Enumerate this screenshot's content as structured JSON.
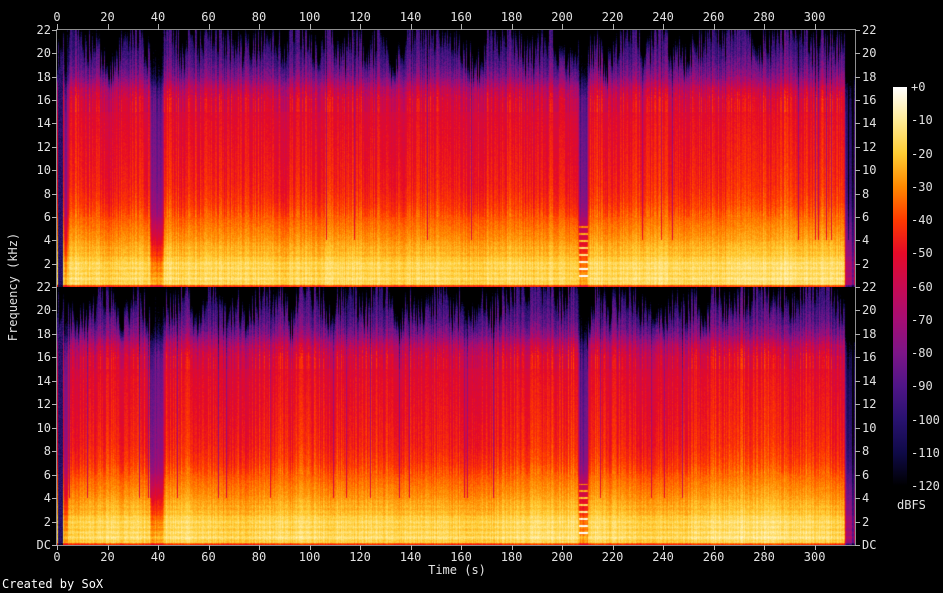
{
  "footer": {
    "credit": "Created by SoX"
  },
  "axes": {
    "x_title": "Time (s)",
    "y_title": "Frequency (kHz)",
    "x_tick_labels": [
      "0",
      "20",
      "40",
      "60",
      "80",
      "100",
      "120",
      "140",
      "160",
      "180",
      "200",
      "220",
      "240",
      "260",
      "280",
      "300"
    ],
    "freq_tick_labels_channel1": [
      "22",
      "20",
      "18",
      "16",
      "14",
      "12",
      "10",
      "8",
      "6",
      "4",
      "2"
    ],
    "freq_tick_labels_channel2": [
      "22",
      "20",
      "18",
      "16",
      "14",
      "12",
      "10",
      "8",
      "6",
      "4",
      "2",
      "DC"
    ]
  },
  "colorbar": {
    "unit_label": "dBFS",
    "tick_labels": [
      "+0",
      "-10",
      "-20",
      "-30",
      "-40",
      "-50",
      "-60",
      "-70",
      "-80",
      "-90",
      "-100",
      "-110",
      "-120"
    ],
    "gradient_hex": [
      "#ffffff",
      "#ffeb96",
      "#ffcc33",
      "#ff8800",
      "#ff3a00",
      "#e50a28",
      "#c70a52",
      "#a50d74",
      "#7d1587",
      "#4f1587",
      "#291270",
      "#0f0a48",
      "#000000"
    ]
  },
  "chart_data": {
    "type": "heatmap",
    "subtype": "stereo_spectrogram",
    "channels": 2,
    "x_axis": {
      "label": "Time (s)",
      "range_s": [
        0,
        316
      ],
      "tick_step_s": 20
    },
    "y_axis": {
      "label": "Frequency (kHz)",
      "range_khz": [
        0,
        22
      ],
      "tick_step_khz": 2,
      "dc_label": "DC"
    },
    "z_axis": {
      "label": "dBFS",
      "range_db": [
        0,
        -120
      ],
      "tick_step_db": 10
    },
    "palette_db_hex": [
      [
        0,
        "#ffffff"
      ],
      [
        -10,
        "#ffeb96"
      ],
      [
        -20,
        "#ffcc33"
      ],
      [
        -30,
        "#ff8800"
      ],
      [
        -40,
        "#ff3a00"
      ],
      [
        -50,
        "#e50a28"
      ],
      [
        -60,
        "#c70a52"
      ],
      [
        -70,
        "#a50d74"
      ],
      [
        -80,
        "#7d1587"
      ],
      [
        -90,
        "#4f1587"
      ],
      [
        -100,
        "#291270"
      ],
      [
        -110,
        "#0f0a48"
      ],
      [
        -120,
        "#000000"
      ]
    ],
    "spectral_profile_khz_db": [
      [
        0,
        -30
      ],
      [
        0.15,
        -22
      ],
      [
        0.4,
        -16
      ],
      [
        1,
        -14
      ],
      [
        2,
        -17
      ],
      [
        3,
        -22
      ],
      [
        4,
        -27
      ],
      [
        5.5,
        -33
      ],
      [
        7,
        -40
      ],
      [
        8.5,
        -44
      ],
      [
        11,
        -47
      ],
      [
        14,
        -50
      ],
      [
        16,
        -54
      ],
      [
        17,
        -62
      ],
      [
        18,
        -78
      ],
      [
        19,
        -88
      ],
      [
        20.5,
        -97
      ],
      [
        22,
        -101
      ]
    ],
    "quiet_regions_s": [
      {
        "start": 0,
        "end": 2.2,
        "attenuation_db": 85,
        "mode": "blackout"
      },
      {
        "start": 2.2,
        "end": 4.6,
        "attenuation_db": 30,
        "mode": "lowpass"
      },
      {
        "start": 36.5,
        "end": 42.5,
        "attenuation_db": 35,
        "mode": "lowpass"
      },
      {
        "start": 206,
        "end": 210.5,
        "attenuation_db": 38,
        "mode": "lowpass"
      },
      {
        "start": 311.5,
        "end": 316,
        "attenuation_db": 52,
        "mode": "uniform"
      }
    ],
    "dotted_tones": {
      "start_s": 206.4,
      "end_s": 210.2,
      "freq_khz_min": 0.8,
      "freq_khz_max": 5.2
    },
    "channel_seeds": [
      1234567,
      987654
    ]
  }
}
